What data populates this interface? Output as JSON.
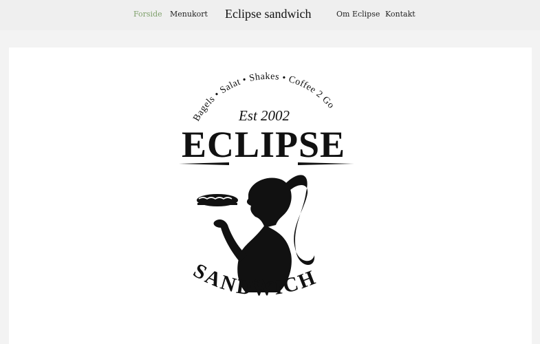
{
  "nav": {
    "forside": "Forside",
    "menukort": "Menukort",
    "brand": "Eclipse sandwich",
    "om": "Om Eclipse",
    "kontakt": "Kontakt",
    "active_color": "#7ea06a"
  },
  "logo": {
    "arc_text": "Bagels • Salat • Shakes • Coffee 2 Go",
    "est": "Est 2002",
    "title": "ECLIPSE",
    "bottom_text": "SANDWICH",
    "images": [
      "woman-silhouette",
      "sandwich"
    ]
  }
}
